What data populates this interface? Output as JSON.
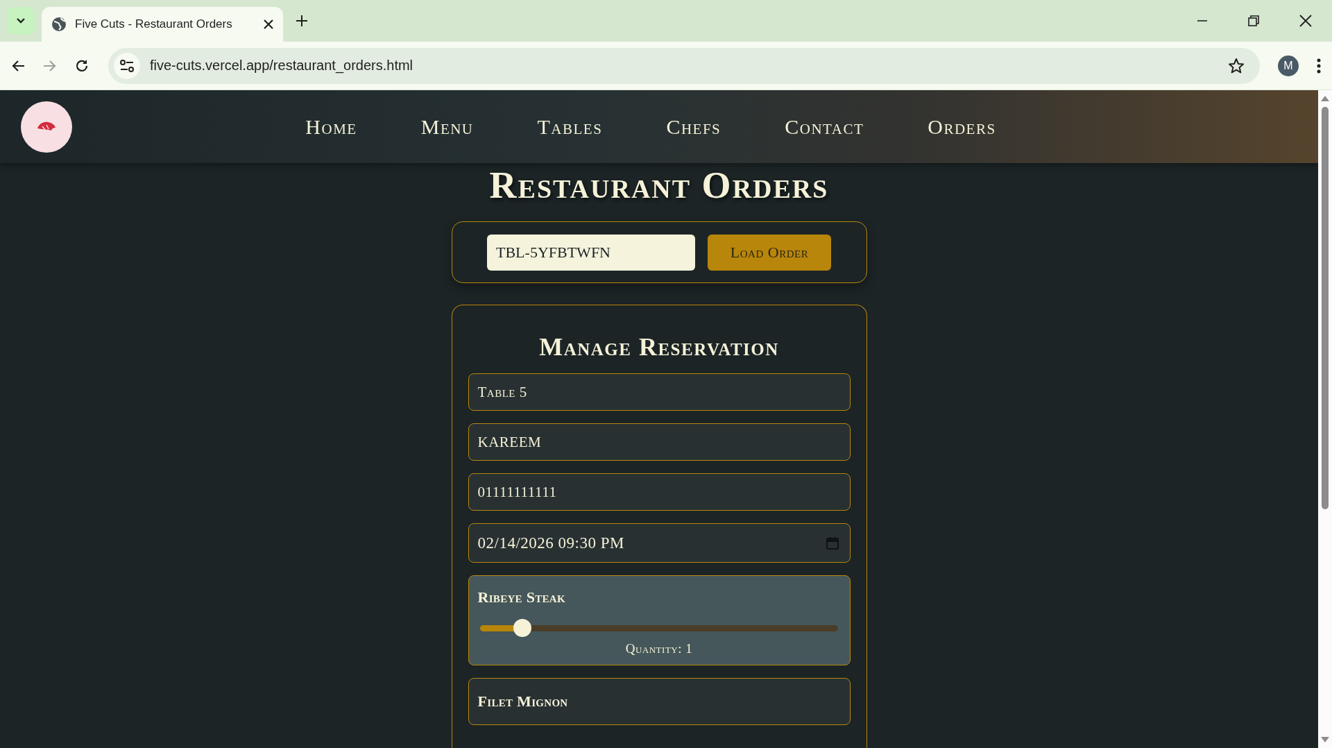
{
  "browser": {
    "tab_title": "Five Cuts - Restaurant Orders",
    "url": "five-cuts.vercel.app/restaurant_orders.html",
    "profile_initial": "M"
  },
  "nav": {
    "links": [
      {
        "label": "Home"
      },
      {
        "label": "Menu"
      },
      {
        "label": "Tables"
      },
      {
        "label": "Chefs"
      },
      {
        "label": "Contact"
      },
      {
        "label": "Orders"
      }
    ]
  },
  "page_title": "Restaurant Orders",
  "order_lookup": {
    "value": "TBL-5YFBTWFN",
    "button": "Load Order"
  },
  "reservation": {
    "title": "Manage Reservation",
    "fields": [
      {
        "kind": "text",
        "value": "Table 5"
      },
      {
        "kind": "text",
        "value": "KAREEM"
      },
      {
        "kind": "text",
        "value": "01111111111"
      },
      {
        "kind": "datetime",
        "value": "02/14/2026 09:30 PM"
      }
    ],
    "dishes": [
      {
        "name": "Ribeye Steak",
        "selected": true,
        "level": 0.12,
        "quantity": "Quantity: 1"
      },
      {
        "name": "Filet Mignon",
        "selected": false
      }
    ]
  }
}
